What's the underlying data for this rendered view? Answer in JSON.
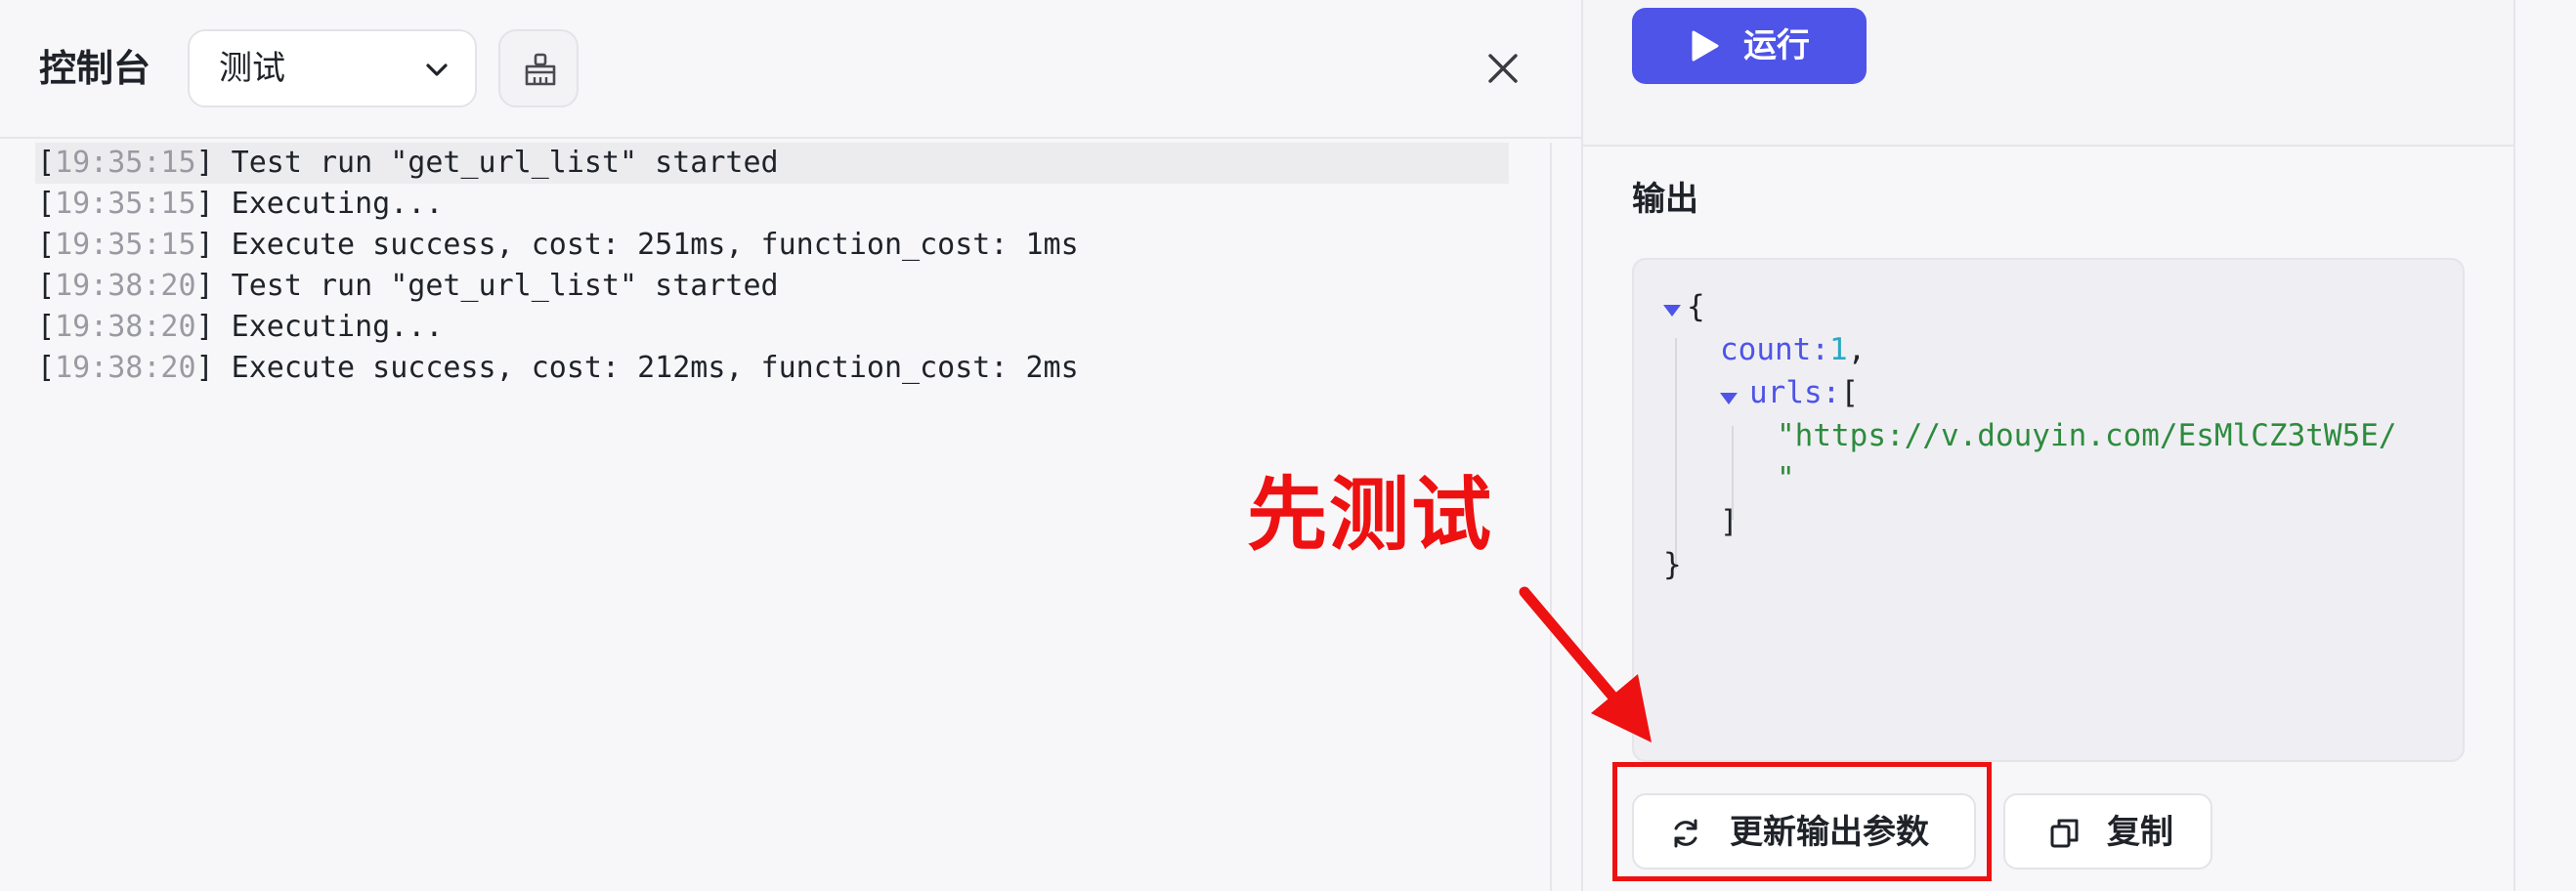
{
  "console": {
    "title": "控制台",
    "environment": {
      "selected": "测试"
    },
    "icons": {
      "clear": "broom-icon",
      "close": "close-icon",
      "dropdown": "chevron-down-icon"
    },
    "logs": [
      {
        "time": "19:35:15",
        "message": " Test run \"get_url_list\" started"
      },
      {
        "time": "19:35:15",
        "message": " Executing..."
      },
      {
        "time": "19:35:15",
        "message": " Execute success, cost: 251ms, function_cost: 1ms"
      },
      {
        "time": "19:38:20",
        "message": " Test run \"get_url_list\" started"
      },
      {
        "time": "19:38:20",
        "message": " Executing..."
      },
      {
        "time": "19:38:20",
        "message": " Execute success, cost: 212ms, function_cost: 2ms"
      }
    ]
  },
  "run_button": {
    "label": "运行",
    "icon": "play-icon"
  },
  "output": {
    "title": "输出",
    "json": {
      "open_brace": "{",
      "count_key": "count:",
      "count_value": "1",
      "comma": ",",
      "urls_key": "urls:",
      "open_bracket": "[",
      "url_line1": "\"https://v.douyin.com/EsMlCZ3tW5E/",
      "url_line2": "\"",
      "close_bracket": "]",
      "close_brace": "}"
    },
    "update_button": {
      "label": "更新输出参数",
      "icon": "refresh-icon"
    },
    "copy_button": {
      "label": "复制",
      "icon": "copy-icon"
    }
  },
  "annotation": {
    "text": "先测试",
    "color": "#ee1111"
  },
  "colors": {
    "accent": "#4e54e8",
    "json_number": "#2aa8c4",
    "json_string": "#2e8b3e"
  }
}
